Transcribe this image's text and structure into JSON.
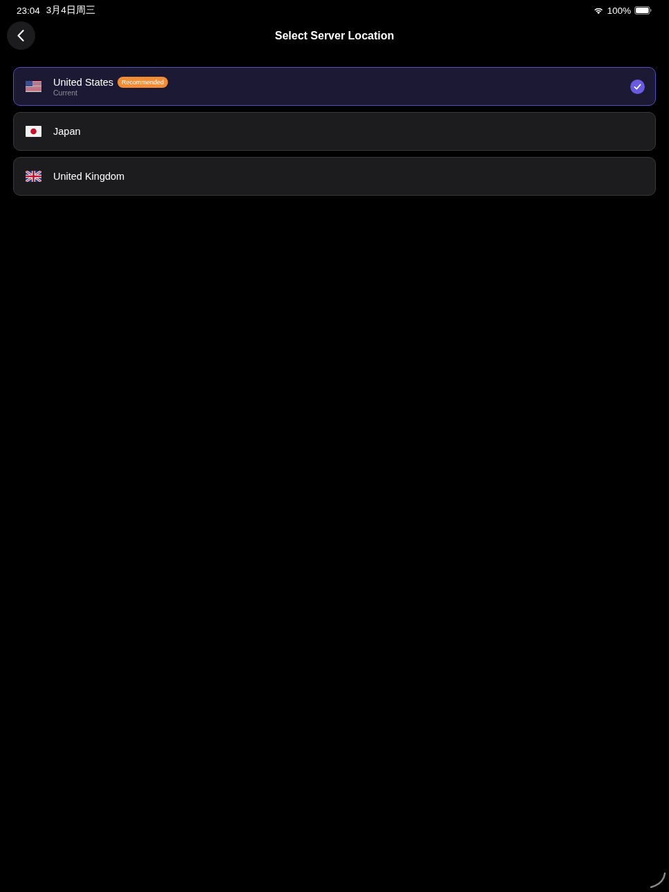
{
  "status_bar": {
    "time": "23:04",
    "date": "3月4日周三",
    "battery": "100%"
  },
  "header": {
    "title": "Select Server Location"
  },
  "locations": [
    {
      "kind": "us",
      "name": "United States",
      "badge": "Recommended",
      "subtitle": "Current",
      "selected": true
    },
    {
      "kind": "jp",
      "name": "Japan",
      "selected": false
    },
    {
      "kind": "gb",
      "name": "United Kingdom",
      "selected": false
    }
  ]
}
